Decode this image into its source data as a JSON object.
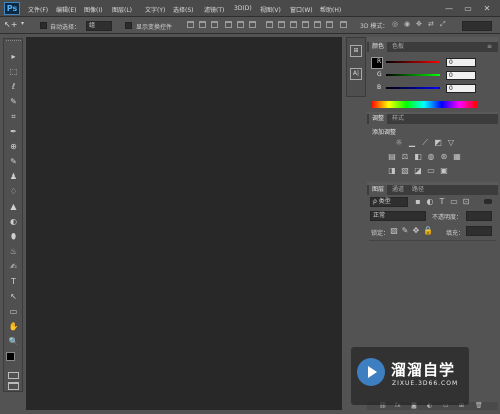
{
  "app": {
    "logo_text": "Ps"
  },
  "menu": {
    "items": [
      "文件(F)",
      "编辑(E)",
      "图像(I)",
      "图层(L)",
      "文字(Y)",
      "选择(S)",
      "滤镜(T)",
      "3D(D)",
      "视图(V)",
      "窗口(W)",
      "帮助(H)"
    ]
  },
  "window_controls": {
    "minimize": "—",
    "restore": "▭",
    "close": "✕"
  },
  "options_bar": {
    "auto_select_label": "自动选择：",
    "auto_select_value": "组",
    "show_transform_label": "显示变换控件",
    "mode_3d_label": "3D 模式："
  },
  "tools": [
    "▸",
    "⬚",
    "ℓ",
    "✎",
    "⌗",
    "✒",
    "⊕",
    "✎",
    "♟",
    "♢",
    "▲",
    "◐",
    "⬮",
    "♨",
    "✍",
    "T",
    "↖",
    "▭",
    "✋",
    "🔍"
  ],
  "panels": {
    "color": {
      "tabs": [
        "颜色",
        "色板"
      ],
      "r_label": "R",
      "g_label": "G",
      "b_label": "B",
      "r_value": "0",
      "g_value": "0",
      "b_value": "0",
      "fg_color": "#000000",
      "bg_color": "#ffffff"
    },
    "adjustments": {
      "tabs": [
        "调整",
        "样式"
      ],
      "title": "添加调整"
    },
    "layers": {
      "tabs": [
        "图层",
        "通道",
        "路径"
      ],
      "filter_label": "ρ 类型",
      "blend_mode": "正常",
      "opacity_label": "不透明度：",
      "lock_label": "锁定：",
      "fill_label": "填充："
    }
  },
  "watermark": {
    "brand": "溜溜自学",
    "site": "ZIXUE.3D66.COM",
    "accent": "#3d7fc0"
  },
  "colors": {
    "canvas_bg": "#282828",
    "panel_bg": "#535353",
    "menubar_bg": "#4a4a4a"
  }
}
